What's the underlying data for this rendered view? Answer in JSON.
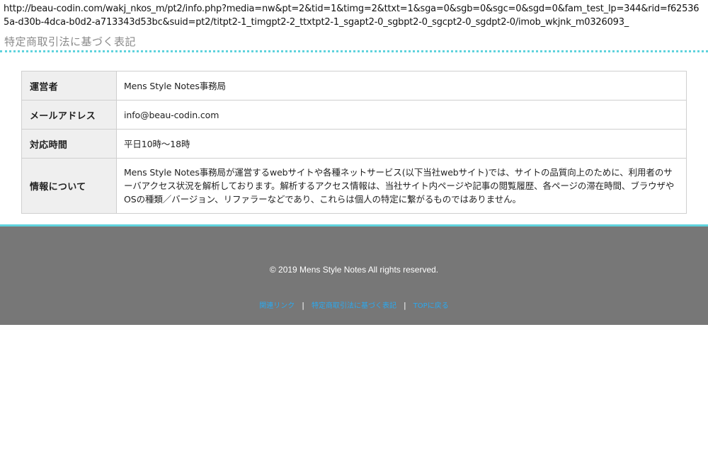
{
  "address_bar": {
    "url": "http://beau-codin.com/wakj_nkos_m/pt2/info.php?media=nw&pt=2&tid=1&timg=2&ttxt=1&sga=0&sgb=0&sgc=0&sgd=0&fam_test_lp=344&rid=f625365a-d30b-4dca-b0d2-a713343d53bc&suid=pt2/titpt2-1_timgpt2-2_ttxtpt2-1_sgapt2-0_sgbpt2-0_sgcpt2-0_sgdpt2-0/imob_wkjnk_m0326093_"
  },
  "page": {
    "heading": "特定商取引法に基づく表記"
  },
  "table": {
    "rows": [
      {
        "label": "運営者",
        "value": "Mens Style Notes事務局"
      },
      {
        "label": "メールアドレス",
        "value": "info@beau-codin.com"
      },
      {
        "label": "対応時間",
        "value": "平日10時～18時"
      },
      {
        "label": "情報について",
        "value": "Mens Style Notes事務局が運営するwebサイトや各種ネットサービス(以下当社webサイト)では、サイトの品質向上のために、利用者のサーバアクセス状況を解析しております。解析するアクセス情報は、当社サイト内ページや記事の閲覧履歴、各ページの滞在時間、ブラウザやOSの種類／バージョン、リファラーなどであり、これらは個人の特定に繋がるものではありません。"
      }
    ]
  },
  "footer": {
    "copyright": "© 2019 Mens Style Notes All rights reserved.",
    "separator": "|",
    "links": [
      {
        "label": "関連リンク"
      },
      {
        "label": "特定商取引法に基づく表記"
      },
      {
        "label": "TOPに戻る"
      }
    ]
  },
  "colors": {
    "accent": "#5fd3dd",
    "footer_bg": "#777777",
    "link": "#2aa9f0",
    "header_cell_bg": "#efefef"
  }
}
